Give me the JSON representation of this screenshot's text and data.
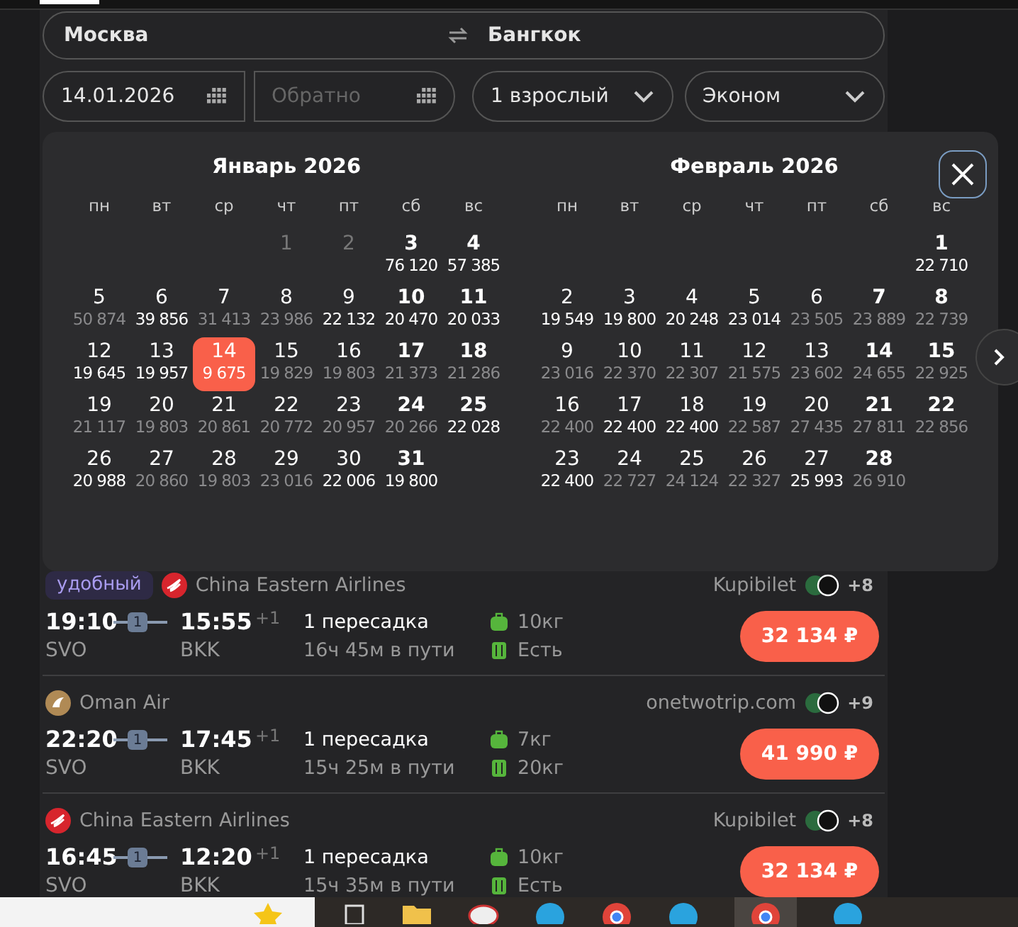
{
  "search": {
    "from": "Москва",
    "to": "Бангкок",
    "date": "14.01.2026",
    "return_placeholder": "Обратно",
    "passengers": "1 взрослый",
    "class": "Эконом"
  },
  "calendar": {
    "months": [
      {
        "title": "Январь 2026",
        "weekdays": [
          "пн",
          "вт",
          "ср",
          "чт",
          "пт",
          "сб",
          "вс"
        ],
        "weeks": [
          [
            {
              "kind": "blank"
            },
            {
              "kind": "blank"
            },
            {
              "kind": "blank"
            },
            {
              "kind": "day",
              "day": "1",
              "disabled": true,
              "selected": false
            },
            {
              "kind": "day",
              "day": "2",
              "disabled": true,
              "selected": false
            },
            {
              "kind": "day",
              "day": "3",
              "price": "76 120",
              "disabled": false,
              "cheap": true,
              "selected": false
            },
            {
              "kind": "day",
              "day": "4",
              "price": "57 385",
              "disabled": false,
              "cheap": true,
              "selected": false
            }
          ],
          [
            {
              "kind": "day",
              "day": "5",
              "price": "50 874",
              "disabled": false,
              "cheap": false,
              "selected": false
            },
            {
              "kind": "day",
              "day": "6",
              "price": "39 856",
              "disabled": false,
              "cheap": true,
              "selected": false
            },
            {
              "kind": "day",
              "day": "7",
              "price": "31 413",
              "disabled": false,
              "cheap": false,
              "selected": false
            },
            {
              "kind": "day",
              "day": "8",
              "price": "23 986",
              "disabled": false,
              "cheap": false,
              "selected": false
            },
            {
              "kind": "day",
              "day": "9",
              "price": "22 132",
              "disabled": false,
              "cheap": true,
              "selected": false
            },
            {
              "kind": "day",
              "day": "10",
              "price": "20 470",
              "disabled": false,
              "cheap": true,
              "selected": false
            },
            {
              "kind": "day",
              "day": "11",
              "price": "20 033",
              "disabled": false,
              "cheap": true,
              "selected": false
            }
          ],
          [
            {
              "kind": "day",
              "day": "12",
              "price": "19 645",
              "disabled": false,
              "cheap": true,
              "selected": false
            },
            {
              "kind": "day",
              "day": "13",
              "price": "19 957",
              "disabled": false,
              "cheap": true,
              "selected": false
            },
            {
              "kind": "day",
              "day": "14",
              "price": "9 675",
              "disabled": false,
              "cheap": true,
              "selected": true
            },
            {
              "kind": "day",
              "day": "15",
              "price": "19 829",
              "disabled": false,
              "cheap": false,
              "selected": false
            },
            {
              "kind": "day",
              "day": "16",
              "price": "19 803",
              "disabled": false,
              "cheap": false,
              "selected": false
            },
            {
              "kind": "day",
              "day": "17",
              "price": "21 373",
              "disabled": false,
              "cheap": false,
              "selected": false
            },
            {
              "kind": "day",
              "day": "18",
              "price": "21 286",
              "disabled": false,
              "cheap": false,
              "selected": false
            }
          ],
          [
            {
              "kind": "day",
              "day": "19",
              "price": "21 117",
              "disabled": false,
              "cheap": false,
              "selected": false
            },
            {
              "kind": "day",
              "day": "20",
              "price": "19 803",
              "disabled": false,
              "cheap": false,
              "selected": false
            },
            {
              "kind": "day",
              "day": "21",
              "price": "20 861",
              "disabled": false,
              "cheap": false,
              "selected": false
            },
            {
              "kind": "day",
              "day": "22",
              "price": "20 772",
              "disabled": false,
              "cheap": false,
              "selected": false
            },
            {
              "kind": "day",
              "day": "23",
              "price": "20 957",
              "disabled": false,
              "cheap": false,
              "selected": false
            },
            {
              "kind": "day",
              "day": "24",
              "price": "20 266",
              "disabled": false,
              "cheap": false,
              "selected": false
            },
            {
              "kind": "day",
              "day": "25",
              "price": "22 028",
              "disabled": false,
              "cheap": true,
              "selected": false
            }
          ],
          [
            {
              "kind": "day",
              "day": "26",
              "price": "20 988",
              "disabled": false,
              "cheap": true,
              "selected": false
            },
            {
              "kind": "day",
              "day": "27",
              "price": "20 860",
              "disabled": false,
              "cheap": false,
              "selected": false
            },
            {
              "kind": "day",
              "day": "28",
              "price": "19 803",
              "disabled": false,
              "cheap": false,
              "selected": false
            },
            {
              "kind": "day",
              "day": "29",
              "price": "23 016",
              "disabled": false,
              "cheap": false,
              "selected": false
            },
            {
              "kind": "day",
              "day": "30",
              "price": "22 006",
              "disabled": false,
              "cheap": true,
              "selected": false
            },
            {
              "kind": "day",
              "day": "31",
              "price": "19 800",
              "disabled": false,
              "cheap": true,
              "selected": false
            }
          ]
        ]
      },
      {
        "title": "Февраль 2026",
        "weekdays": [
          "пн",
          "вт",
          "ср",
          "чт",
          "пт",
          "сб",
          "вс"
        ],
        "weeks": [
          [
            {
              "kind": "blank"
            },
            {
              "kind": "blank"
            },
            {
              "kind": "blank"
            },
            {
              "kind": "blank"
            },
            {
              "kind": "blank"
            },
            {
              "kind": "blank"
            },
            {
              "kind": "day",
              "day": "1",
              "price": "22 710",
              "disabled": false,
              "cheap": true,
              "selected": false
            }
          ],
          [
            {
              "kind": "day",
              "day": "2",
              "price": "19 549",
              "disabled": false,
              "cheap": true,
              "selected": false
            },
            {
              "kind": "day",
              "day": "3",
              "price": "19 800",
              "disabled": false,
              "cheap": true,
              "selected": false
            },
            {
              "kind": "day",
              "day": "4",
              "price": "20 248",
              "disabled": false,
              "cheap": true,
              "selected": false
            },
            {
              "kind": "day",
              "day": "5",
              "price": "23 014",
              "disabled": false,
              "cheap": true,
              "selected": false
            },
            {
              "kind": "day",
              "day": "6",
              "price": "23 505",
              "disabled": false,
              "cheap": false,
              "selected": false
            },
            {
              "kind": "day",
              "day": "7",
              "price": "23 889",
              "disabled": false,
              "cheap": false,
              "selected": false
            },
            {
              "kind": "day",
              "day": "8",
              "price": "22 739",
              "disabled": false,
              "cheap": false,
              "selected": false
            }
          ],
          [
            {
              "kind": "day",
              "day": "9",
              "price": "23 016",
              "disabled": false,
              "cheap": false,
              "selected": false
            },
            {
              "kind": "day",
              "day": "10",
              "price": "22 370",
              "disabled": false,
              "cheap": false,
              "selected": false
            },
            {
              "kind": "day",
              "day": "11",
              "price": "22 307",
              "disabled": false,
              "cheap": false,
              "selected": false
            },
            {
              "kind": "day",
              "day": "12",
              "price": "21 575",
              "disabled": false,
              "cheap": false,
              "selected": false
            },
            {
              "kind": "day",
              "day": "13",
              "price": "23 602",
              "disabled": false,
              "cheap": false,
              "selected": false
            },
            {
              "kind": "day",
              "day": "14",
              "price": "24 655",
              "disabled": false,
              "cheap": false,
              "selected": false
            },
            {
              "kind": "day",
              "day": "15",
              "price": "22 925",
              "disabled": false,
              "cheap": false,
              "selected": false
            }
          ],
          [
            {
              "kind": "day",
              "day": "16",
              "price": "22 400",
              "disabled": false,
              "cheap": false,
              "selected": false
            },
            {
              "kind": "day",
              "day": "17",
              "price": "22 400",
              "disabled": false,
              "cheap": true,
              "selected": false
            },
            {
              "kind": "day",
              "day": "18",
              "price": "22 400",
              "disabled": false,
              "cheap": true,
              "selected": false
            },
            {
              "kind": "day",
              "day": "19",
              "price": "22 587",
              "disabled": false,
              "cheap": false,
              "selected": false
            },
            {
              "kind": "day",
              "day": "20",
              "price": "27 435",
              "disabled": false,
              "cheap": false,
              "selected": false
            },
            {
              "kind": "day",
              "day": "21",
              "price": "27 811",
              "disabled": false,
              "cheap": false,
              "selected": false
            },
            {
              "kind": "day",
              "day": "22",
              "price": "22 856",
              "disabled": false,
              "cheap": false,
              "selected": false
            }
          ],
          [
            {
              "kind": "day",
              "day": "23",
              "price": "22 400",
              "disabled": false,
              "cheap": true,
              "selected": false
            },
            {
              "kind": "day",
              "day": "24",
              "price": "22 727",
              "disabled": false,
              "cheap": false,
              "selected": false
            },
            {
              "kind": "day",
              "day": "25",
              "price": "24 124",
              "disabled": false,
              "cheap": false,
              "selected": false
            },
            {
              "kind": "day",
              "day": "26",
              "price": "22 327",
              "disabled": false,
              "cheap": false,
              "selected": false
            },
            {
              "kind": "day",
              "day": "27",
              "price": "25 993",
              "disabled": false,
              "cheap": true,
              "selected": false
            },
            {
              "kind": "day",
              "day": "28",
              "price": "26 910",
              "disabled": false,
              "cheap": false,
              "selected": false
            }
          ]
        ]
      }
    ]
  },
  "flights": [
    {
      "badge": "удобный",
      "airline": "China Eastern Airlines",
      "kind": "china",
      "agency": "Kupibilet",
      "more": "+8",
      "dep_time": "19:10",
      "stops": "1",
      "arr_time": "15:55",
      "next_day": "+1",
      "from": "SVO",
      "to": "BKK",
      "transfer": "1 пересадка",
      "duration": "16ч 45м в пути",
      "hand_luggage": "10кг",
      "baggage": "Есть",
      "price": "32 134 ₽"
    },
    {
      "airline": "Oman Air",
      "kind": "oman",
      "agency": "onetwotrip.com",
      "more": "+9",
      "dep_time": "22:20",
      "stops": "1",
      "arr_time": "17:45",
      "next_day": "+1",
      "from": "SVO",
      "to": "BKK",
      "transfer": "1 пересадка",
      "duration": "15ч 25м в пути",
      "hand_luggage": "7кг",
      "baggage": "20кг",
      "price": "41 990 ₽"
    },
    {
      "airline": "China Eastern Airlines",
      "kind": "china",
      "agency": "Kupibilet",
      "more": "+8",
      "dep_time": "16:45",
      "stops": "1",
      "arr_time": "12:20",
      "next_day": "+1",
      "from": "SVO",
      "to": "BKK",
      "transfer": "1 пересадка",
      "duration": "15ч 35м в пути",
      "hand_luggage": "10кг",
      "baggage": "Есть",
      "price": "32 134 ₽"
    }
  ]
}
